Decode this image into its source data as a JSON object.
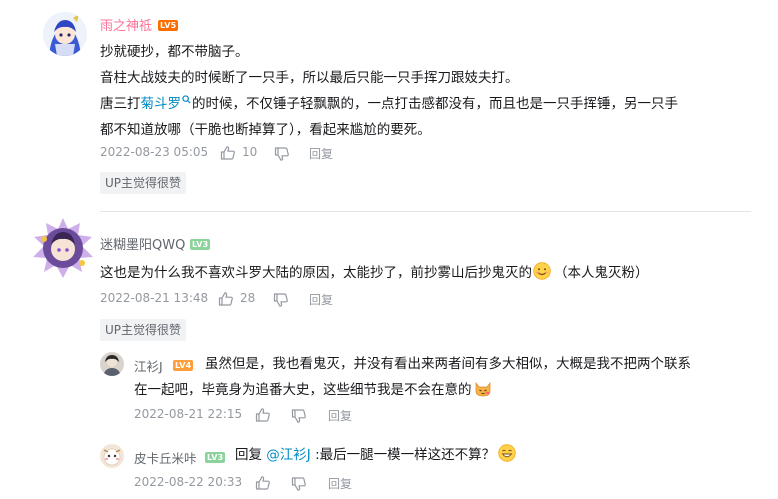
{
  "comments": [
    {
      "username": "雨之神祗",
      "level": "LV5",
      "lines": [
        "抄就硬抄，都不带脑子。",
        "音柱大战妓夫的时候断了一只手，所以最后只能一只手挥刀跟妓夫打。"
      ],
      "line3_pre": "唐三打",
      "line3_link": "菊斗罗",
      "line3_post": "的时候，不仅锤子轻飘飘的，一点打击感都没有，而且也是一只手挥锤，另一只手",
      "line4": "都不知道放哪（干脆也断掉算了），看起来尴尬的要死。",
      "time": "2022-08-23 05:05",
      "likes": "10",
      "reply_label": "回复",
      "up_badge": "UP主觉得很赞"
    },
    {
      "username": "迷糊墨阳QWQ",
      "level": "LV3",
      "text": "这也是为什么我不喜欢斗罗大陆的原因，太能抄了，前抄雾山后抄鬼灭的",
      "text_after": "（本人鬼灭粉）",
      "time": "2022-08-21 13:48",
      "likes": "28",
      "reply_label": "回复",
      "up_badge": "UP主觉得很赞",
      "replies": [
        {
          "username": "江衫J",
          "level": "LV4",
          "line1": "虽然但是，我也看鬼灭，并没有看出来两者间有多大相似，大概是我不把两个联系",
          "line2": "在一起吧，毕竟身为追番大史，这些细节我是不会在意的",
          "time": "2022-08-21 22:15",
          "reply_label": "回复"
        },
        {
          "username": "皮卡丘米咔",
          "level": "LV3",
          "prefix": "回复 ",
          "mention": "@江衫J",
          "text": " :最后一腿一模一样这还不算？",
          "time": "2022-08-22 20:33",
          "reply_label": "回复"
        }
      ]
    }
  ],
  "colors": {
    "username_pink": "#fb7299",
    "username_gray": "#61666d",
    "link_blue": "#008ac5",
    "lv5": "#ff6c00",
    "lv4": "#ff9f3c",
    "lv3": "#8bd29b",
    "meta_gray": "#9499a0"
  }
}
